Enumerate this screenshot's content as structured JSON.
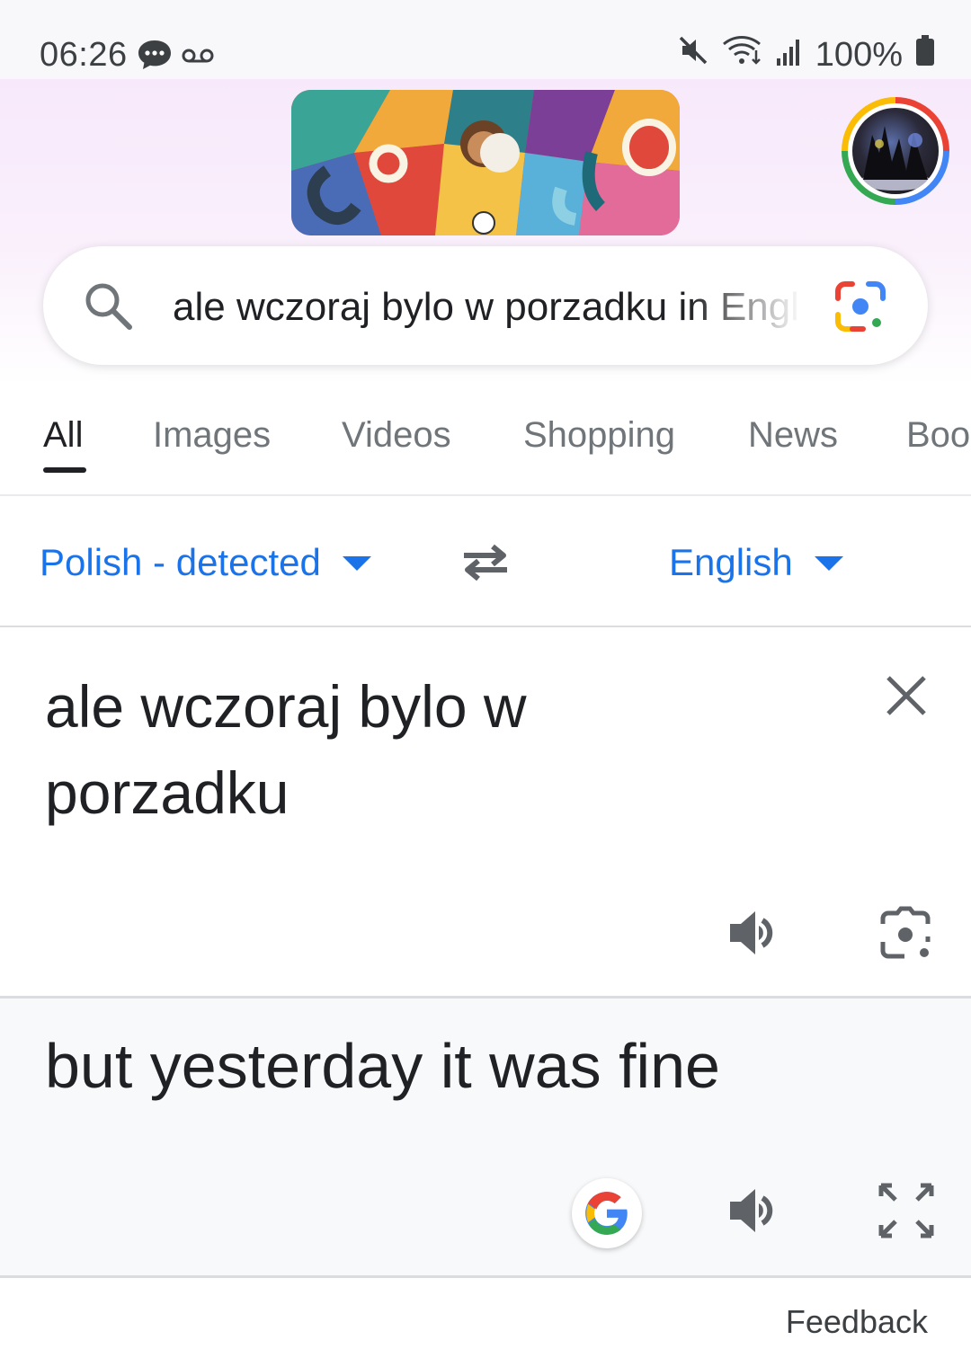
{
  "status_bar": {
    "time": "06:26",
    "battery": "100%"
  },
  "search": {
    "query": "ale wczoraj bylo w porzadku in English"
  },
  "tabs": [
    "All",
    "Images",
    "Videos",
    "Shopping",
    "News",
    "Books"
  ],
  "translate": {
    "source_lang": "Polish - detected",
    "target_lang": "English",
    "source_text": "ale wczoraj bylo w porzadku",
    "target_text": "but yesterday it was fine"
  },
  "footer": {
    "feedback_label": "Feedback"
  },
  "colors": {
    "link_blue": "#1a73e8",
    "text_dark": "#202124",
    "icon_gray": "#5f6368"
  }
}
